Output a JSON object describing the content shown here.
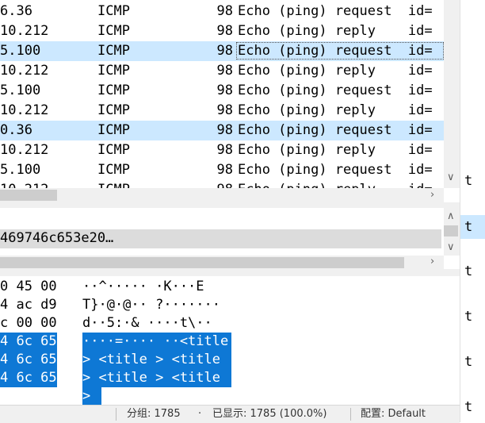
{
  "packets": [
    {
      "src": "6.36",
      "proto": "ICMP",
      "len": "98",
      "info": "Echo (ping) request  id=",
      "selected": false
    },
    {
      "src": "10.212",
      "proto": "ICMP",
      "len": "98",
      "info": "Echo (ping) reply    id=",
      "selected": false
    },
    {
      "src": "5.100",
      "proto": "ICMP",
      "len": "98",
      "info": "Echo (ping) request  id=",
      "selected": true
    },
    {
      "src": "10.212",
      "proto": "ICMP",
      "len": "98",
      "info": "Echo (ping) reply    id=",
      "selected": false
    },
    {
      "src": "5.100",
      "proto": "ICMP",
      "len": "98",
      "info": "Echo (ping) request  id=",
      "selected": false
    },
    {
      "src": "10.212",
      "proto": "ICMP",
      "len": "98",
      "info": "Echo (ping) reply    id=",
      "selected": false
    },
    {
      "src": "0.36",
      "proto": "ICMP",
      "len": "98",
      "info": "Echo (ping) request  id=",
      "selected": true
    },
    {
      "src": "10.212",
      "proto": "ICMP",
      "len": "98",
      "info": "Echo (ping) reply    id=",
      "selected": false
    },
    {
      "src": "5.100",
      "proto": "ICMP",
      "len": "98",
      "info": "Echo (ping) request  id=",
      "selected": false
    },
    {
      "src": "10.212",
      "proto": "ICMP",
      "len": "98",
      "info": "Echo (ping) reply    id=",
      "selected": false
    }
  ],
  "details": {
    "hex_summary": "469746c653e20…"
  },
  "bytes": {
    "hex_lines": [
      "0 45 00",
      "4 ac d9",
      "c 00 00",
      "4 6c 65",
      "4 6c 65",
      "4 6c 65"
    ],
    "ascii_lines": [
      "··^····· ·K···E",
      "T}·@·@·· ?·······",
      "d··5:·& ····t\\··",
      "····=···· ··<title",
      "> <title > <title",
      "> <title > <title",
      ">"
    ]
  },
  "right_panel": {
    "letters": [
      "t",
      "t",
      "t",
      "t",
      "t",
      "t",
      "t"
    ]
  },
  "statusbar": {
    "packets": "分组: 1785",
    "bullet": "·",
    "displayed": "已显示: 1785 (100.0%)",
    "profile": "配置: Default"
  },
  "colors": {
    "selection_light": "#cce8ff",
    "selection_strong": "#0e78d5",
    "toolbar_bg": "#f0f0f0"
  }
}
